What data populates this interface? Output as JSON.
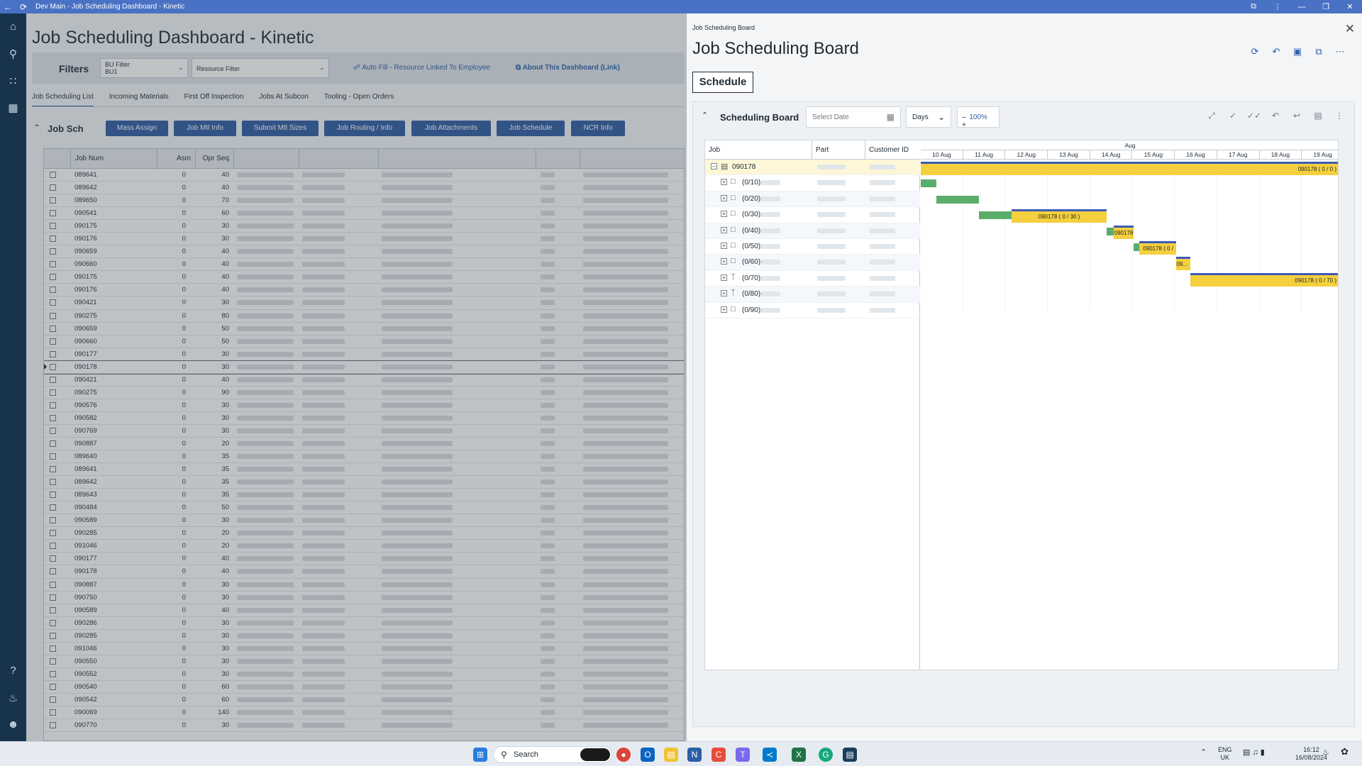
{
  "window": {
    "title": "Dev Main - Job Scheduling Dashboard - Kinetic"
  },
  "dashboard": {
    "title": "Job Scheduling Dashboard - Kinetic",
    "filters_label": "Filters",
    "bu_filter": {
      "label": "BU Filter",
      "value": "BU1"
    },
    "resource_filter": {
      "placeholder": "Resource Filter"
    },
    "auto_fill_link": "Auto Fill - Resource Linked To Employee",
    "about_link": "About This Dashboard (Link)",
    "tabs": [
      "Job Scheduling List",
      "Incoming Materials",
      "First Off Inspection",
      "Jobs At Subcon",
      "Tooling - Open Orders"
    ],
    "active_tab": 0,
    "section_title": "Job Sch",
    "actions": [
      "Mass Assign",
      "Job Mtl Info",
      "Submit Mtl Sizes",
      "Job Routing / Info",
      "Job Attachments",
      "Job Schedule",
      "NCR Info"
    ],
    "grid_headers": [
      "Job Num",
      "Asm",
      "Opr Seq"
    ],
    "grid_rows": [
      [
        "089641",
        "0",
        "40"
      ],
      [
        "089642",
        "0",
        "40"
      ],
      [
        "089650",
        "0",
        "70"
      ],
      [
        "090541",
        "0",
        "60"
      ],
      [
        "090175",
        "0",
        "30"
      ],
      [
        "090176",
        "0",
        "30"
      ],
      [
        "090659",
        "0",
        "40"
      ],
      [
        "090660",
        "0",
        "40"
      ],
      [
        "090175",
        "0",
        "40"
      ],
      [
        "090176",
        "0",
        "40"
      ],
      [
        "090421",
        "0",
        "30"
      ],
      [
        "090275",
        "0",
        "80"
      ],
      [
        "090659",
        "0",
        "50"
      ],
      [
        "090660",
        "0",
        "50"
      ],
      [
        "090177",
        "0",
        "30"
      ],
      [
        "090178",
        "0",
        "30"
      ],
      [
        "090421",
        "0",
        "40"
      ],
      [
        "090275",
        "0",
        "90"
      ],
      [
        "090576",
        "0",
        "30"
      ],
      [
        "090582",
        "0",
        "30"
      ],
      [
        "090769",
        "0",
        "30"
      ],
      [
        "090887",
        "0",
        "20"
      ],
      [
        "089640",
        "0",
        "35"
      ],
      [
        "089641",
        "0",
        "35"
      ],
      [
        "089642",
        "0",
        "35"
      ],
      [
        "089643",
        "0",
        "35"
      ],
      [
        "090484",
        "0",
        "50"
      ],
      [
        "090589",
        "0",
        "30"
      ],
      [
        "090285",
        "0",
        "20"
      ],
      [
        "091046",
        "0",
        "20"
      ],
      [
        "090177",
        "0",
        "40"
      ],
      [
        "090178",
        "0",
        "40"
      ],
      [
        "090887",
        "0",
        "30"
      ],
      [
        "090750",
        "0",
        "30"
      ],
      [
        "090589",
        "0",
        "40"
      ],
      [
        "090286",
        "0",
        "30"
      ],
      [
        "090285",
        "0",
        "30"
      ],
      [
        "091046",
        "0",
        "30"
      ],
      [
        "090550",
        "0",
        "30"
      ],
      [
        "090552",
        "0",
        "30"
      ],
      [
        "090540",
        "0",
        "60"
      ],
      [
        "090542",
        "0",
        "60"
      ],
      [
        "090069",
        "0",
        "140"
      ],
      [
        "090770",
        "0",
        "30"
      ]
    ],
    "selected_row": 15
  },
  "panel": {
    "breadcrumb": "Job Scheduling Board",
    "title": "Job Scheduling Board",
    "schedule_tab": "Schedule",
    "board_title": "Scheduling Board",
    "date_placeholder": "Select Date",
    "view_mode": "Days",
    "zoom": "100%",
    "tree_headers": [
      "Job",
      "Part",
      "Customer ID"
    ],
    "month": "Aug",
    "days": [
      "10 Aug",
      "11 Aug",
      "12 Aug",
      "13 Aug",
      "14 Aug",
      "15 Aug",
      "16 Aug",
      "17 Aug",
      "18 Aug",
      "19 Aug"
    ],
    "tree": [
      {
        "label": "090178",
        "type": "job"
      },
      {
        "label": "(0/10)",
        "type": "folder"
      },
      {
        "label": "(0/20)",
        "type": "folder"
      },
      {
        "label": "(0/30)",
        "type": "folder"
      },
      {
        "label": "(0/40)",
        "type": "folder"
      },
      {
        "label": "(0/50)",
        "type": "folder"
      },
      {
        "label": "(0/60)",
        "type": "folder"
      },
      {
        "label": "(0/70)",
        "type": "branch"
      },
      {
        "label": "(0/80)",
        "type": "branch"
      },
      {
        "label": "(0/90)",
        "type": "folder"
      }
    ],
    "bar_labels": {
      "parent": "090178 ( 0 / 0 )",
      "op30": "090178 ( 0 / 30 )",
      "op40": "090178",
      "op50": "090178 ( 0 /",
      "op60": "09...",
      "op70": "090178 ( 0 / 70 )"
    }
  },
  "taskbar": {
    "search_placeholder": "Search",
    "lang": "ENG",
    "region": "UK",
    "time": "16:12",
    "date": "16/08/2024"
  },
  "colors": {
    "accent": "#2d5aa0",
    "titlebar": "#4a72c4",
    "nav": "#18344d",
    "bar_yellow": "#f4d03f",
    "bar_green": "#5cad6c",
    "bar_top": "#3d5bb5"
  }
}
